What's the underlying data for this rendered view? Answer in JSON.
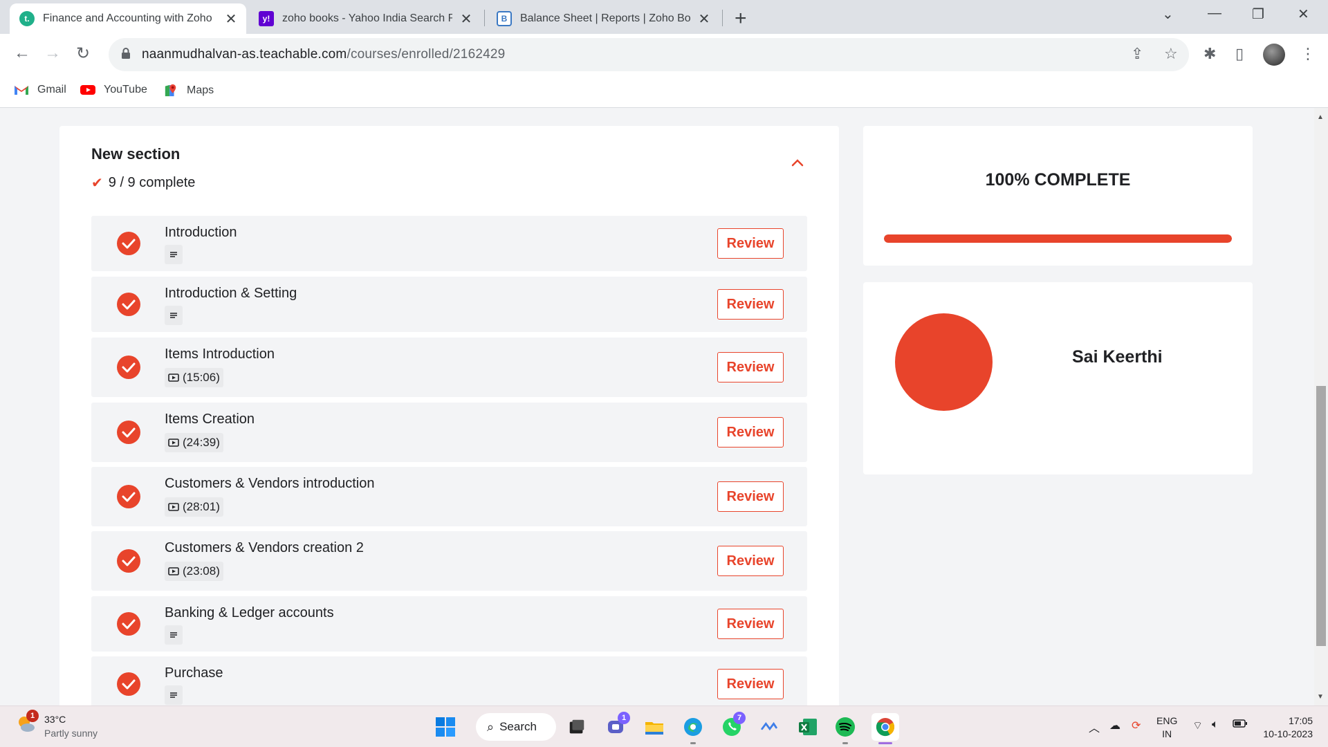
{
  "browser": {
    "tabs": [
      {
        "title": "Finance and Accounting with Zoho",
        "active": true
      },
      {
        "title": "zoho books - Yahoo India Search Re",
        "active": false
      },
      {
        "title": "Balance Sheet | Reports | Zoho Boo",
        "active": false
      }
    ],
    "new_tab_label": "+",
    "address_host": "naanmudhalvan-as.teachable.com",
    "address_path": "/courses/enrolled/2162429",
    "bookmarks": [
      {
        "label": "Gmail",
        "icon": "gmail-icon"
      },
      {
        "label": "YouTube",
        "icon": "youtube-icon"
      },
      {
        "label": "Maps",
        "icon": "maps-icon"
      }
    ]
  },
  "course_section": {
    "title": "New section",
    "progress_text": "9 / 9 complete",
    "review_label": "Review",
    "lessons": [
      {
        "name": "Introduction",
        "type": "text",
        "duration": ""
      },
      {
        "name": "Introduction & Setting",
        "type": "text",
        "duration": ""
      },
      {
        "name": "Items Introduction",
        "type": "video",
        "duration": "(15:06)"
      },
      {
        "name": "Items Creation",
        "type": "video",
        "duration": "(24:39)"
      },
      {
        "name": "Customers & Vendors introduction",
        "type": "video",
        "duration": "(28:01)"
      },
      {
        "name": "Customers & Vendors creation 2",
        "type": "video",
        "duration": "(23:08)"
      },
      {
        "name": "Banking & Ledger accounts",
        "type": "text",
        "duration": ""
      },
      {
        "name": "Purchase",
        "type": "text",
        "duration": ""
      }
    ]
  },
  "progress": {
    "label": "100% COMPLETE",
    "fraction": 1.0
  },
  "profile": {
    "name": "Sai Keerthi"
  },
  "theme": {
    "accent": "#e8442b",
    "card_bg": "#ffffff",
    "page_bg": "#f3f4f6"
  },
  "taskbar": {
    "weather_temp": "33°C",
    "weather_condition": "Partly sunny",
    "weather_badge": "1",
    "search_label": "Search",
    "teams_badge": "1",
    "whatsapp_badge": "7",
    "lang_line1": "ENG",
    "lang_line2": "IN",
    "time": "17:05",
    "date": "10-10-2023"
  }
}
